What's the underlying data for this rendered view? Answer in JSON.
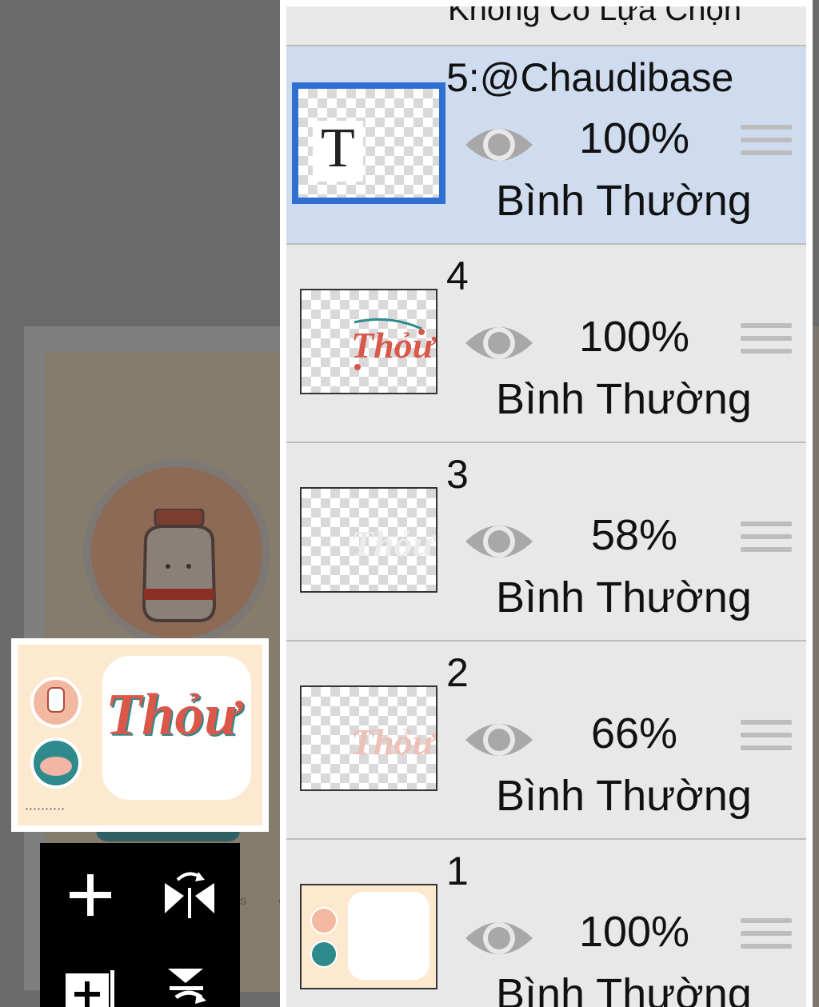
{
  "panel": {
    "header_label": "Không Có Lựa Chọn",
    "layers": [
      {
        "number": "5:@Chaudibase",
        "opacity": "100%",
        "blend_mode": "Bình Thường",
        "selected": true,
        "thumb": "text-T",
        "thumb_letter": "T"
      },
      {
        "number": "4",
        "opacity": "100%",
        "blend_mode": "Bình Thường",
        "selected": false,
        "thumb": "lettering-red"
      },
      {
        "number": "3",
        "opacity": "58%",
        "blend_mode": "Bình Thường",
        "selected": false,
        "thumb": "lettering-white"
      },
      {
        "number": "2",
        "opacity": "66%",
        "blend_mode": "Bình Thường",
        "selected": false,
        "thumb": "lettering-pink"
      },
      {
        "number": "1",
        "opacity": "100%",
        "blend_mode": "Bình Thường",
        "selected": false,
        "thumb": "background-art"
      }
    ]
  },
  "preview": {
    "lettering": "Thỏư"
  },
  "canvas": {
    "stray_text": "s e"
  },
  "toolbar": {
    "tools": [
      "add-layer-icon",
      "flip-horizontal-icon",
      "add-layer-copy-icon",
      "merge-down-icon"
    ]
  },
  "colors": {
    "selection_blue": "#2f6fd4",
    "selected_row": "#cfdcf0",
    "panel_bg": "#e8e8e8",
    "lettering_red": "#d9584a",
    "lettering_teal": "#2f8a8c"
  }
}
